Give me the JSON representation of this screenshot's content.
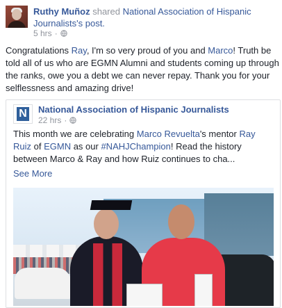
{
  "post": {
    "author": "Ruthy Muñoz",
    "shared_text": "shared",
    "page_name": "National Association of Hispanic Journalists",
    "possessive": "'s post.",
    "time": "5 hrs",
    "separator": "·",
    "body": {
      "part1": "Congratulations ",
      "mention1": "Ray",
      "part2": ", I'm so very proud of you and ",
      "mention2": "Marco",
      "part3": "! Truth be told all of us who are EGMN Alumni and students coming up through the ranks, owe you a debt we can never repay. Thank you for your selflessness and amazing drive!"
    }
  },
  "shared_post": {
    "logo_letter": "N",
    "org": "National Association of Hispanic Journalists",
    "time": "22 hrs",
    "separator": "·",
    "text": {
      "part1": "This month we are celebrating ",
      "mention1": "Marco Revuelta",
      "part2": "'s mentor ",
      "mention2": "Ray Ruiz",
      "part3": " of ",
      "mention3": "EGMN",
      "part4": " as our ",
      "hashtag": "#NAHJChampion",
      "part5": "! Read the history between Marco & Ray and how Ruiz continues to cha..."
    },
    "see_more": "See More"
  },
  "icons": {
    "globe": "globe-icon"
  },
  "colors": {
    "link": "#365899",
    "meta": "#90949c",
    "text": "#1d2129"
  }
}
